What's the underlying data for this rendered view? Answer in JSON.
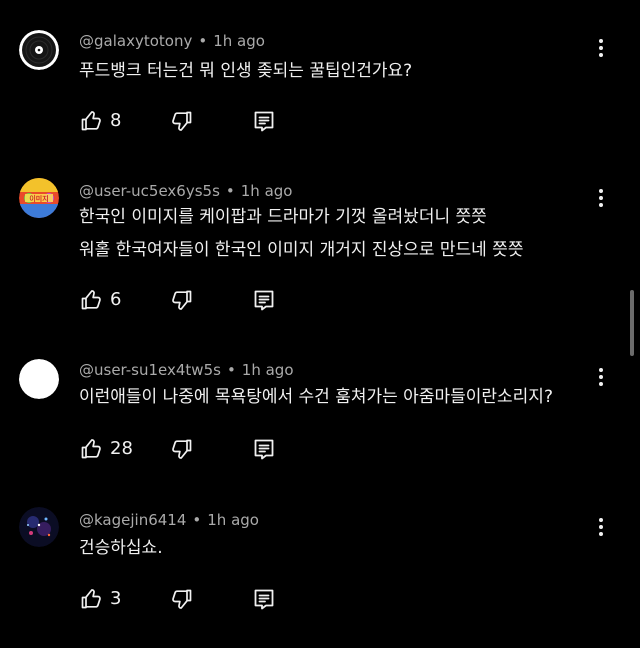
{
  "comments": [
    {
      "author": "@galaxytotony",
      "time": "1h ago",
      "lines": [
        "푸드뱅크 터는건 뭐 인생 좆되는 꿀팁인건가요?"
      ],
      "likes": "8"
    },
    {
      "author": "@user-uc5ex6ys5s",
      "time": "1h ago",
      "lines": [
        "한국인 이미지를 케이팝과 드라마가 기껏 올려놨더니 쯧쯧",
        "워홀 한국여자들이 한국인 이미지 개거지 진상으로 만드네 쯧쯧"
      ],
      "likes": "6"
    },
    {
      "author": "@user-su1ex4tw5s",
      "time": "1h ago",
      "lines": [
        "이런애들이 나중에 목욕탕에서 수건 훔쳐가는 아줌마들이란소리지?"
      ],
      "likes": "28"
    },
    {
      "author": "@kagejin6414",
      "time": "1h ago",
      "lines": [
        "건승하십쇼."
      ],
      "likes": "3"
    }
  ],
  "meta_separator": "•",
  "colors": {
    "background": "#000000",
    "text_primary": "#f1f1f1",
    "text_secondary": "#aaaaaa",
    "scrollbar": "#6b6b6b"
  },
  "icons": {
    "menu": "three-dots-vertical-icon",
    "like": "thumbs-up-icon",
    "dislike": "thumbs-down-icon",
    "reply": "reply-icon"
  }
}
